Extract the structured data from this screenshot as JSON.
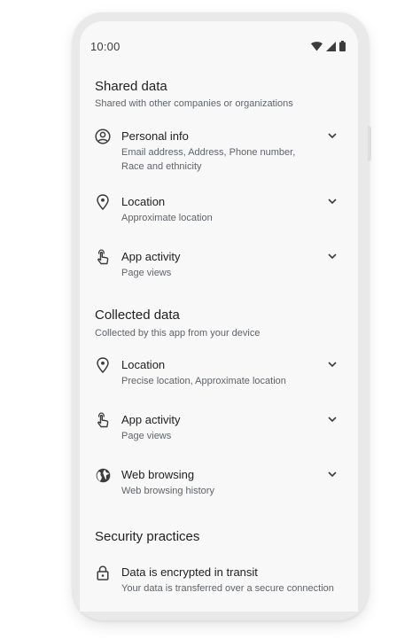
{
  "status_bar": {
    "time": "10:00",
    "icons": [
      "wifi-icon",
      "cellular-signal-icon",
      "battery-icon"
    ]
  },
  "shared_data": {
    "title": "Shared data",
    "subtitle": "Shared with other companies or organizations",
    "items": [
      {
        "icon": "account-circle-icon",
        "title": "Personal info",
        "description": "Email address, Address, Phone number, Race and ethnicity"
      },
      {
        "icon": "location-pin-icon",
        "title": "Location",
        "description": "Approximate location"
      },
      {
        "icon": "touch-hand-icon",
        "title": "App activity",
        "description": "Page views"
      }
    ]
  },
  "collected_data": {
    "title": "Collected data",
    "subtitle": "Collected by this app from your device",
    "items": [
      {
        "icon": "location-pin-icon",
        "title": "Location",
        "description": "Precise location, Approximate location"
      },
      {
        "icon": "touch-hand-icon",
        "title": "App activity",
        "description": "Page views"
      },
      {
        "icon": "globe-icon",
        "title": "Web browsing",
        "description": "Web browsing history"
      }
    ]
  },
  "security": {
    "title": "Security practices",
    "items": [
      {
        "icon": "lock-icon",
        "title": "Data is encrypted in transit",
        "description": "Your data is transferred over a secure connection"
      }
    ]
  },
  "colors": {
    "primary_text": "#202124",
    "secondary_text": "#5f6368",
    "screen_bg": "#f8f8f8",
    "frame": "#e9e9e9"
  }
}
